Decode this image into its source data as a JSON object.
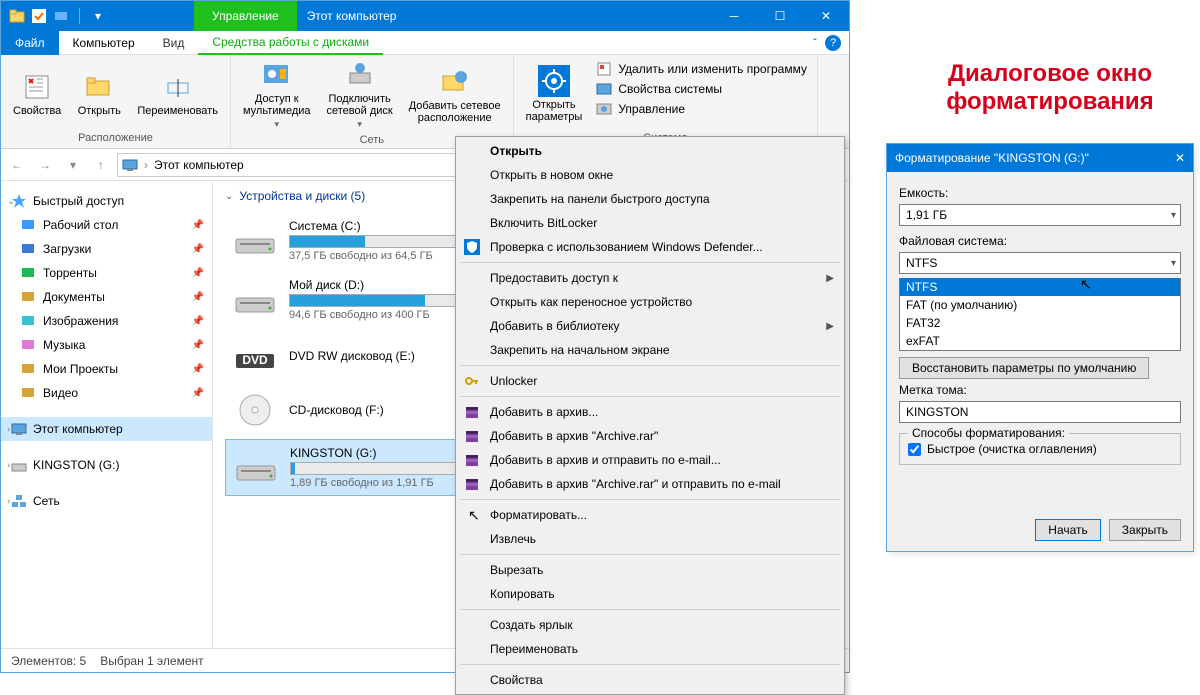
{
  "titlebar": {
    "manage": "Управление",
    "title": "Этот компьютер"
  },
  "tabs": {
    "file": "Файл",
    "computer": "Компьютер",
    "view": "Вид",
    "drives": "Средства работы с дисками"
  },
  "ribbon": {
    "loc_group": "Расположение",
    "net_group": "Сеть",
    "sys_group": "Система",
    "props": "Свойства",
    "open": "Открыть",
    "rename": "Переименовать",
    "media": "Доступ к\nмультимедиа",
    "netdrive": "Подключить\nсетевой диск",
    "netloc": "Добавить сетевое\nрасположение",
    "openparams": "Открыть\nпараметры",
    "sys1": "Удалить или изменить программу",
    "sys2": "Свойства системы",
    "sys3": "Управление"
  },
  "address": "Этот компьютер",
  "sidebar": {
    "quick": "Быстрый доступ",
    "items": [
      {
        "label": "Рабочий стол",
        "pin": true
      },
      {
        "label": "Загрузки",
        "pin": true
      },
      {
        "label": "Торренты",
        "pin": true
      },
      {
        "label": "Документы",
        "pin": true
      },
      {
        "label": "Изображения",
        "pin": true
      },
      {
        "label": "Музыка",
        "pin": true
      },
      {
        "label": "Мои Проекты",
        "pin": true
      },
      {
        "label": "Видео",
        "pin": true
      }
    ],
    "thispc": "Этот компьютер",
    "kingston": "KINGSTON (G:)",
    "network": "Сеть"
  },
  "section": "Устройства и диски (5)",
  "drives": [
    {
      "name": "Система (C:)",
      "free": "37,5 ГБ свободно из 64,5 ГБ",
      "pct": 42
    },
    {
      "name": "Мой диск (D:)",
      "free": "94,6 ГБ свободно из 400 ГБ",
      "pct": 76
    },
    {
      "name": "DVD RW дисковод (E:)",
      "free": "",
      "pct": -1,
      "type": "dvd"
    },
    {
      "name": "CD-дисковод (F:)",
      "free": "",
      "pct": -1,
      "type": "cd"
    },
    {
      "name": "KINGSTON (G:)",
      "free": "1,89 ГБ свободно из 1,91 ГБ",
      "pct": 2,
      "sel": true
    }
  ],
  "status": {
    "count": "Элементов: 5",
    "sel": "Выбран 1 элемент"
  },
  "ctx": [
    {
      "t": "Открыть",
      "bold": true
    },
    {
      "t": "Открыть в новом окне"
    },
    {
      "t": "Закрепить на панели быстрого доступа"
    },
    {
      "t": "Включить BitLocker"
    },
    {
      "t": "Проверка с использованием Windows Defender...",
      "icon": "shield"
    },
    {
      "sep": true
    },
    {
      "t": "Предоставить доступ к",
      "sub": true
    },
    {
      "t": "Открыть как переносное устройство"
    },
    {
      "t": "Добавить в библиотеку",
      "sub": true
    },
    {
      "t": "Закрепить на начальном экране"
    },
    {
      "sep": true
    },
    {
      "t": "Unlocker",
      "icon": "key"
    },
    {
      "sep": true
    },
    {
      "t": "Добавить в архив...",
      "icon": "rar"
    },
    {
      "t": "Добавить в архив \"Archive.rar\"",
      "icon": "rar"
    },
    {
      "t": "Добавить в архив и отправить по e-mail...",
      "icon": "rar"
    },
    {
      "t": "Добавить в архив \"Archive.rar\" и отправить по e-mail",
      "icon": "rar"
    },
    {
      "sep": true
    },
    {
      "t": "Форматировать...",
      "cursor": true
    },
    {
      "t": "Извлечь"
    },
    {
      "sep": true
    },
    {
      "t": "Вырезать"
    },
    {
      "t": "Копировать"
    },
    {
      "sep": true
    },
    {
      "t": "Создать ярлык"
    },
    {
      "t": "Переименовать"
    },
    {
      "sep": true
    },
    {
      "t": "Свойства"
    }
  ],
  "redhead": "Диалоговое окно форматирования",
  "fmt": {
    "title": "Форматирование \"KINGSTON (G:)\"",
    "capacity_l": "Емкость:",
    "capacity": "1,91 ГБ",
    "fs_l": "Файловая система:",
    "fs": "NTFS",
    "fs_opts": [
      "NTFS",
      "FAT (по умолчанию)",
      "FAT32",
      "exFAT"
    ],
    "restore": "Восстановить параметры по умолчанию",
    "vol_l": "Метка тома:",
    "vol": "KINGSTON",
    "ways": "Способы форматирования:",
    "quick": "Быстрое (очистка оглавления)",
    "start": "Начать",
    "close": "Закрыть"
  }
}
